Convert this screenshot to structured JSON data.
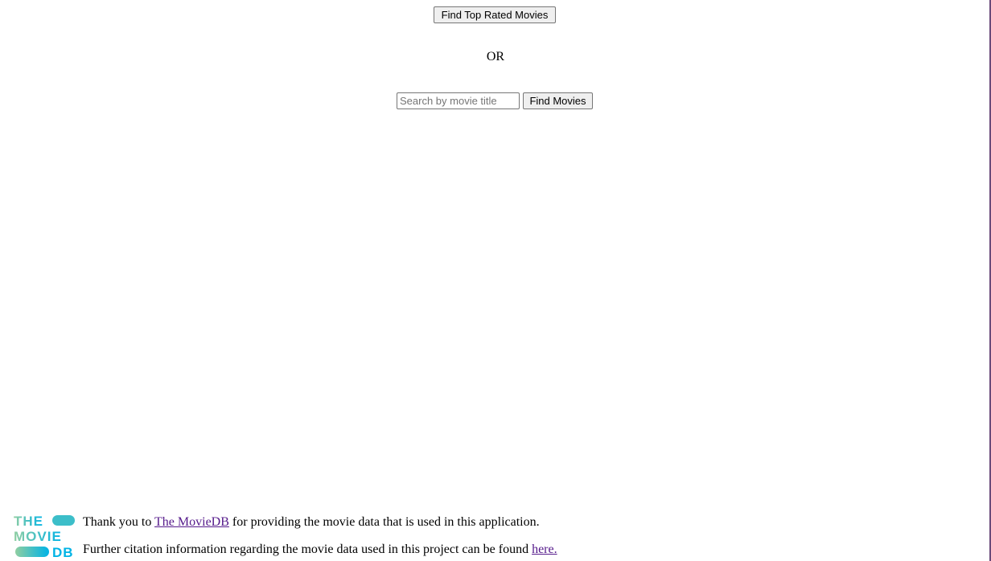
{
  "buttons": {
    "top_rated": "Find Top Rated Movies",
    "find_movies": "Find Movies"
  },
  "separator": "OR",
  "search": {
    "placeholder": "Search by movie title",
    "value": ""
  },
  "footer": {
    "logo": {
      "icon": "tmdb-logo",
      "text_lines": [
        "THE",
        "MOVIE",
        "DB"
      ],
      "colors": [
        "#90cea1",
        "#3cbec9",
        "#00b3e5"
      ]
    },
    "line1": {
      "prefix": "Thank you to ",
      "link_text": "The MovieDB",
      "suffix": " for providing the movie data that is used in this application."
    },
    "line2": {
      "prefix": "Further citation information regarding the movie data used in this project can be found ",
      "link_text": "here."
    }
  }
}
